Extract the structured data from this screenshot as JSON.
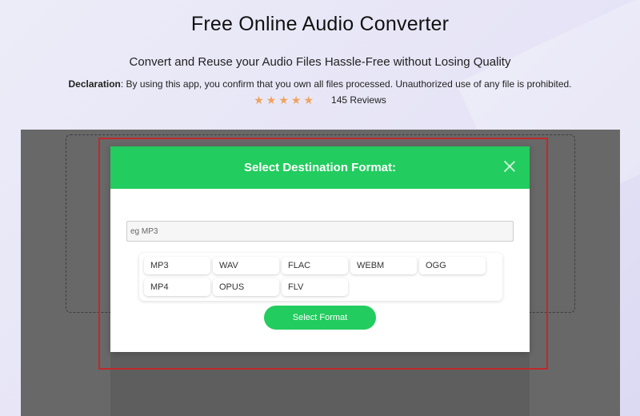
{
  "hero": {
    "title": "Free Online Audio Converter",
    "subtitle": "Convert and Reuse your Audio Files Hassle-Free without Losing Quality",
    "declaration_label": "Declaration",
    "declaration_text": ": By using this app, you confirm that you own all files processed. Unauthorized use of any file is prohibited.",
    "rating_stars": 5,
    "reviews": "145 Reviews"
  },
  "modal": {
    "title": "Select Destination Format:",
    "search_placeholder": "eg MP3",
    "formats": [
      "MP3",
      "WAV",
      "FLAC",
      "WEBM",
      "OGG",
      "MP4",
      "OPUS",
      "FLV"
    ],
    "select_button": "Select Format"
  },
  "colors": {
    "accent_green": "#22cc5e",
    "star_orange": "#f0a35e",
    "highlight_red": "#c0282a",
    "overlay_gray": "#686868"
  },
  "icons": {
    "close": "close-icon",
    "star": "star-icon"
  }
}
